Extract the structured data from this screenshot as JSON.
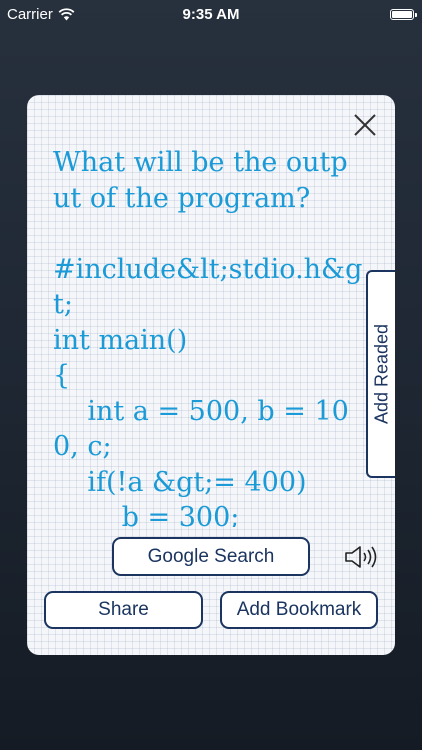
{
  "status_bar": {
    "carrier": "Carrier",
    "time": "9:35 AM"
  },
  "card": {
    "question_text": "What will be the output of the program?\n\n#include&lt;stdio.h&gt;\nint main()\n{\n    int a = 500, b = 100, c;\n    if(!a &gt;= 400)\n        b = 300;",
    "add_readed_label": "Add Readed",
    "google_search_label": "Google Search",
    "share_label": "Share",
    "add_bookmark_label": "Add Bookmark"
  },
  "icons": {
    "close": "close-icon",
    "speaker": "speaker-icon",
    "wifi": "wifi-icon",
    "battery": "battery-icon"
  },
  "colors": {
    "question_text": "#1a9ad6",
    "button_border": "#1b3560",
    "card_background": "#f4f6fa"
  }
}
